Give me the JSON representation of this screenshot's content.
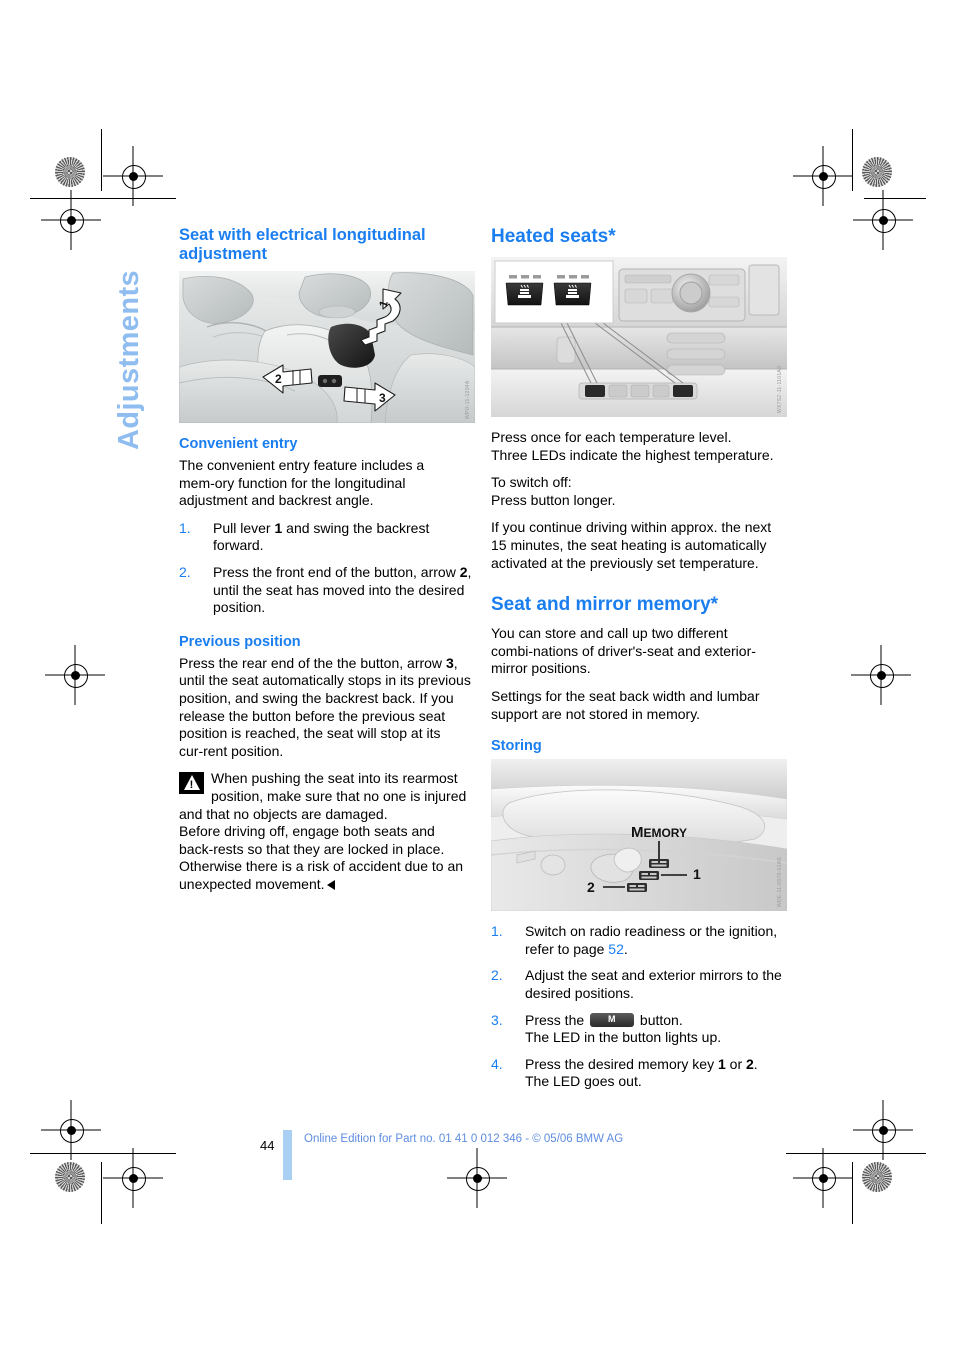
{
  "side_tab": {
    "label": "Adjustments"
  },
  "left_column": {
    "heading": "Seat with electrical longitudinal adjustment",
    "figure_credit": "WPO-11-1204A",
    "convenient_entry": {
      "heading": "Convenient entry",
      "intro": "The convenient entry feature includes a mem‑ory function for the longitudinal adjustment and backrest angle.",
      "steps": [
        {
          "num": "1.",
          "text_before": "Pull lever ",
          "bold": "1",
          "text_after": " and swing the backrest forward."
        },
        {
          "num": "2.",
          "text_before": "Press the front end of the button, arrow ",
          "bold": "2",
          "text_after": ", until the seat has moved into the desired position."
        }
      ]
    },
    "previous_position": {
      "heading": "Previous position",
      "body_before": "Press the rear end of the the button, arrow ",
      "body_bold": "3",
      "body_after": ", until the seat automatically stops in its previous position, and swing the backrest back. If you release the button before the previous seat position is reached, the seat will stop at its cur‑rent position.",
      "warning_lead": "When pushing the seat into its rearmost position, make sure that no one is injured and that no objects are damaged.",
      "warning_rest": "Before driving off, engage both seats and back‑rests so that they are locked in place. Otherwise there is a risk of accident due to an unexpected movement."
    }
  },
  "right_column": {
    "heated_seats": {
      "heading": "Heated seats*",
      "figure_credit": "WX7SZ-11-1101AS",
      "para1": "Press once for each temperature level.\nThree LEDs indicate the highest temperature.",
      "para2": "To switch off:\nPress button longer.",
      "para3": "If you continue driving within approx. the next 15 minutes, the seat heating is automatically activated at the previously set temperature."
    },
    "seat_mirror_memory": {
      "heading": "Seat and mirror memory*",
      "para1": "You can store and call up two different combi‑nations of driver's-seat and exterior-mirror positions.",
      "para2": "Settings for the seat back width and lumbar support are not stored in memory.",
      "storing_heading": "Storing",
      "figure_credit": "WDE-11-0970-01AS",
      "figure_labels": {
        "memory": "MEMORY",
        "key1": "1",
        "key2": "2"
      },
      "steps": [
        {
          "num": "1.",
          "text_before": "Switch on radio readiness or the ignition, refer to page ",
          "link": "52",
          "text_after": "."
        },
        {
          "num": "2.",
          "text_before": "Adjust the seat and exterior mirrors to the desired positions.",
          "text_after": ""
        },
        {
          "num": "3.",
          "text_before": "Press the ",
          "button_glyph": "M",
          "text_after": " button.\nThe LED in the button lights up."
        },
        {
          "num": "4.",
          "text_before": "Press the desired memory key ",
          "bold1": "1",
          "mid": " or ",
          "bold2": "2",
          "text_after": ".\nThe LED goes out."
        }
      ]
    }
  },
  "footer": {
    "page_number": "44",
    "note": "Online Edition for Part no. 01 41 0 012 346 - © 05/06 BMW AG"
  },
  "colors": {
    "accent_blue": "#1a7ef0",
    "tab_blue": "#8fbdf0",
    "footer_blue": "#5f8de0",
    "footer_bar": "#a9cff3"
  }
}
